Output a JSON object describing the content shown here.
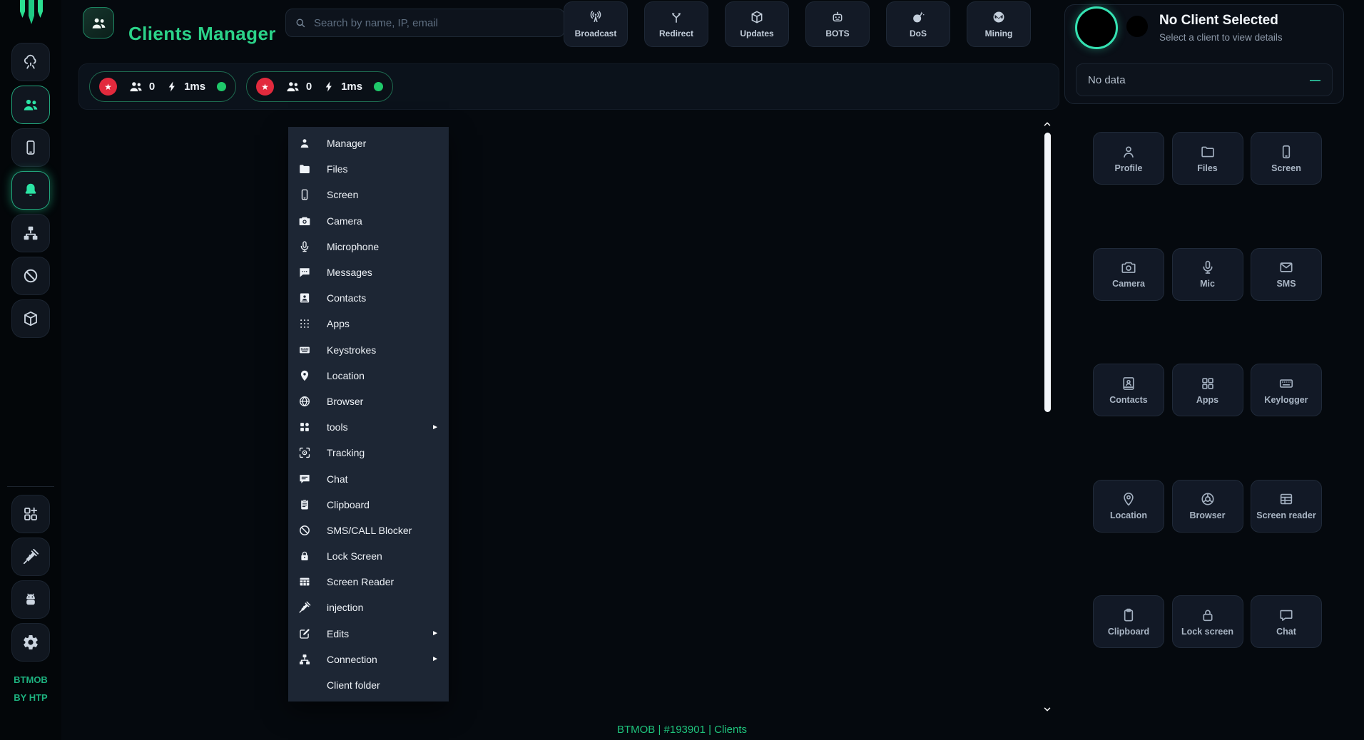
{
  "app": {
    "title": "Clients Manager",
    "brand_line1": "BTMOB",
    "brand_line2": "BY HTP"
  },
  "header": {
    "search_placeholder": "Search by name, IP, email",
    "actions": [
      {
        "label": "Broadcast",
        "icon": "broadcast-icon"
      },
      {
        "label": "Redirect",
        "icon": "redirect-icon"
      },
      {
        "label": "Updates",
        "icon": "package-icon"
      },
      {
        "label": "BOTS",
        "icon": "robot-icon"
      },
      {
        "label": "DoS",
        "icon": "bomb-icon"
      },
      {
        "label": "Mining",
        "icon": "monero-icon"
      }
    ]
  },
  "sidebar": {
    "top_items": [
      {
        "name": "cloud",
        "icon": "cloud-network-icon",
        "active": false,
        "glow": false
      },
      {
        "name": "clients",
        "icon": "users-icon",
        "active": true,
        "glow": false
      },
      {
        "name": "devices",
        "icon": "device-icon",
        "active": false,
        "glow": false
      },
      {
        "name": "notifications",
        "icon": "bell-icon",
        "active": true,
        "glow": true
      },
      {
        "name": "connections",
        "icon": "sitemap-icon",
        "active": false,
        "glow": false
      },
      {
        "name": "blocked",
        "icon": "ban-icon",
        "active": false,
        "glow": false
      },
      {
        "name": "builds",
        "icon": "package-icon",
        "active": false,
        "glow": false
      }
    ],
    "bottom_items": [
      {
        "name": "apps",
        "icon": "grid-plus-icon"
      },
      {
        "name": "injection",
        "icon": "syringe-icon"
      },
      {
        "name": "android",
        "icon": "android-icon"
      },
      {
        "name": "settings",
        "icon": "gear-icon"
      }
    ]
  },
  "status_bar": {
    "pills": [
      {
        "badge": "★",
        "count": "0",
        "latency": "1ms"
      },
      {
        "badge": "★",
        "count": "0",
        "latency": "1ms"
      }
    ]
  },
  "context_menu": {
    "submenu_arrow": "►",
    "items": [
      {
        "label": "Manager",
        "icon": "person-icon",
        "submenu": false
      },
      {
        "label": "Files",
        "icon": "folder-icon",
        "submenu": false
      },
      {
        "label": "Screen",
        "icon": "device-icon",
        "submenu": false
      },
      {
        "label": "Camera",
        "icon": "camera-icon",
        "submenu": false
      },
      {
        "label": "Microphone",
        "icon": "mic-icon",
        "submenu": false
      },
      {
        "label": "Messages",
        "icon": "message-icon",
        "submenu": false
      },
      {
        "label": "Contacts",
        "icon": "contact-card-icon",
        "submenu": false
      },
      {
        "label": "Apps",
        "icon": "dots-grid-icon",
        "submenu": false
      },
      {
        "label": "Keystrokes",
        "icon": "keyboard-icon",
        "submenu": false
      },
      {
        "label": "Location",
        "icon": "pin-icon",
        "submenu": false
      },
      {
        "label": "Browser",
        "icon": "globe-icon",
        "submenu": false
      },
      {
        "label": "tools",
        "icon": "tools-icon",
        "submenu": true
      },
      {
        "label": "Tracking",
        "icon": "tracking-icon",
        "submenu": false
      },
      {
        "label": "Chat",
        "icon": "chat-icon",
        "submenu": false
      },
      {
        "label": "Clipboard",
        "icon": "clipboard-icon",
        "submenu": false
      },
      {
        "label": "SMS/CALL Blocker",
        "icon": "ban-icon",
        "submenu": false
      },
      {
        "label": "Lock Screen",
        "icon": "lock-icon",
        "submenu": false
      },
      {
        "label": "Screen Reader",
        "icon": "table-icon",
        "submenu": false
      },
      {
        "label": "injection",
        "icon": "syringe-icon",
        "submenu": false
      },
      {
        "label": "Edits",
        "icon": "edit-icon",
        "submenu": true
      },
      {
        "label": "Connection",
        "icon": "sitemap-icon",
        "submenu": true
      },
      {
        "label": "Client folder",
        "icon": "",
        "submenu": false
      }
    ]
  },
  "right_panel": {
    "title": "No Client Selected",
    "subtitle": "Select a client to view details",
    "no_data": {
      "label": "No data",
      "dash": "—"
    },
    "actions": [
      {
        "label": "Profile",
        "icon": "profile-icon"
      },
      {
        "label": "Files",
        "icon": "folder-outline-icon"
      },
      {
        "label": "Screen",
        "icon": "device-icon"
      },
      {
        "label": "Camera",
        "icon": "camera-outline-icon"
      },
      {
        "label": "Mic",
        "icon": "mic-icon"
      },
      {
        "label": "SMS",
        "icon": "envelope-icon"
      },
      {
        "label": "Contacts",
        "icon": "contact-book-icon"
      },
      {
        "label": "Apps",
        "icon": "apps-icon"
      },
      {
        "label": "Keylogger",
        "icon": "keyboard-outline-icon"
      },
      {
        "label": "Location",
        "icon": "pin-outline-icon"
      },
      {
        "label": "Browser",
        "icon": "browser-icon"
      },
      {
        "label": "Screen reader",
        "icon": "table-outline-icon"
      },
      {
        "label": "Clipboard",
        "icon": "clipboard-outline-icon"
      },
      {
        "label": "Lock screen",
        "icon": "lock-outline-icon"
      },
      {
        "label": "Chat",
        "icon": "chat-outline-icon"
      }
    ]
  },
  "footer": {
    "text": "BTMOB | #193901 | Clients"
  },
  "colors": {
    "accent": "#2bd389",
    "ring": "#35e2b2",
    "danger": "#e22a3d",
    "online": "#1fc96a"
  }
}
